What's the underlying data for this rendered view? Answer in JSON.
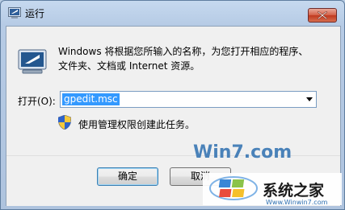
{
  "window": {
    "title": "运行"
  },
  "dialog": {
    "description_line1": "Windows 将根据您所输入的名称，为您打开相应的程序、",
    "description_line2": "文件夹、文档或 Internet 资源。",
    "open_label": "打开(O):",
    "open_value": "gpedit.msc",
    "admin_note": "使用管理权限创建此任务。"
  },
  "buttons": {
    "ok": "确定",
    "cancel": "取消"
  },
  "watermark": {
    "brand": "Win7.com",
    "site_name": "系统之家",
    "url": "Www.Winwin7.com"
  },
  "colors": {
    "selection": "#3399ff",
    "close_button": "#c83c22",
    "watermark_blue": "#2e6fb0"
  },
  "icons": [
    "run-icon",
    "close-icon",
    "dropdown-arrow-icon",
    "uac-shield-icon",
    "windows-logo-icon"
  ]
}
